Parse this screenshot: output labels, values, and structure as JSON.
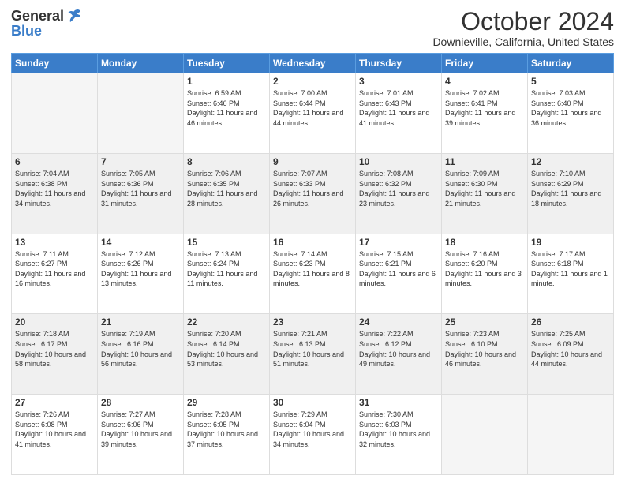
{
  "header": {
    "logo_general": "General",
    "logo_blue": "Blue",
    "month_title": "October 2024",
    "location": "Downieville, California, United States"
  },
  "days_of_week": [
    "Sunday",
    "Monday",
    "Tuesday",
    "Wednesday",
    "Thursday",
    "Friday",
    "Saturday"
  ],
  "weeks": [
    [
      {
        "day": "",
        "sunrise": "",
        "sunset": "",
        "daylight": "",
        "empty": true
      },
      {
        "day": "",
        "sunrise": "",
        "sunset": "",
        "daylight": "",
        "empty": true
      },
      {
        "day": "1",
        "sunrise": "Sunrise: 6:59 AM",
        "sunset": "Sunset: 6:46 PM",
        "daylight": "Daylight: 11 hours and 46 minutes."
      },
      {
        "day": "2",
        "sunrise": "Sunrise: 7:00 AM",
        "sunset": "Sunset: 6:44 PM",
        "daylight": "Daylight: 11 hours and 44 minutes."
      },
      {
        "day": "3",
        "sunrise": "Sunrise: 7:01 AM",
        "sunset": "Sunset: 6:43 PM",
        "daylight": "Daylight: 11 hours and 41 minutes."
      },
      {
        "day": "4",
        "sunrise": "Sunrise: 7:02 AM",
        "sunset": "Sunset: 6:41 PM",
        "daylight": "Daylight: 11 hours and 39 minutes."
      },
      {
        "day": "5",
        "sunrise": "Sunrise: 7:03 AM",
        "sunset": "Sunset: 6:40 PM",
        "daylight": "Daylight: 11 hours and 36 minutes."
      }
    ],
    [
      {
        "day": "6",
        "sunrise": "Sunrise: 7:04 AM",
        "sunset": "Sunset: 6:38 PM",
        "daylight": "Daylight: 11 hours and 34 minutes."
      },
      {
        "day": "7",
        "sunrise": "Sunrise: 7:05 AM",
        "sunset": "Sunset: 6:36 PM",
        "daylight": "Daylight: 11 hours and 31 minutes."
      },
      {
        "day": "8",
        "sunrise": "Sunrise: 7:06 AM",
        "sunset": "Sunset: 6:35 PM",
        "daylight": "Daylight: 11 hours and 28 minutes."
      },
      {
        "day": "9",
        "sunrise": "Sunrise: 7:07 AM",
        "sunset": "Sunset: 6:33 PM",
        "daylight": "Daylight: 11 hours and 26 minutes."
      },
      {
        "day": "10",
        "sunrise": "Sunrise: 7:08 AM",
        "sunset": "Sunset: 6:32 PM",
        "daylight": "Daylight: 11 hours and 23 minutes."
      },
      {
        "day": "11",
        "sunrise": "Sunrise: 7:09 AM",
        "sunset": "Sunset: 6:30 PM",
        "daylight": "Daylight: 11 hours and 21 minutes."
      },
      {
        "day": "12",
        "sunrise": "Sunrise: 7:10 AM",
        "sunset": "Sunset: 6:29 PM",
        "daylight": "Daylight: 11 hours and 18 minutes."
      }
    ],
    [
      {
        "day": "13",
        "sunrise": "Sunrise: 7:11 AM",
        "sunset": "Sunset: 6:27 PM",
        "daylight": "Daylight: 11 hours and 16 minutes."
      },
      {
        "day": "14",
        "sunrise": "Sunrise: 7:12 AM",
        "sunset": "Sunset: 6:26 PM",
        "daylight": "Daylight: 11 hours and 13 minutes."
      },
      {
        "day": "15",
        "sunrise": "Sunrise: 7:13 AM",
        "sunset": "Sunset: 6:24 PM",
        "daylight": "Daylight: 11 hours and 11 minutes."
      },
      {
        "day": "16",
        "sunrise": "Sunrise: 7:14 AM",
        "sunset": "Sunset: 6:23 PM",
        "daylight": "Daylight: 11 hours and 8 minutes."
      },
      {
        "day": "17",
        "sunrise": "Sunrise: 7:15 AM",
        "sunset": "Sunset: 6:21 PM",
        "daylight": "Daylight: 11 hours and 6 minutes."
      },
      {
        "day": "18",
        "sunrise": "Sunrise: 7:16 AM",
        "sunset": "Sunset: 6:20 PM",
        "daylight": "Daylight: 11 hours and 3 minutes."
      },
      {
        "day": "19",
        "sunrise": "Sunrise: 7:17 AM",
        "sunset": "Sunset: 6:18 PM",
        "daylight": "Daylight: 11 hours and 1 minute."
      }
    ],
    [
      {
        "day": "20",
        "sunrise": "Sunrise: 7:18 AM",
        "sunset": "Sunset: 6:17 PM",
        "daylight": "Daylight: 10 hours and 58 minutes."
      },
      {
        "day": "21",
        "sunrise": "Sunrise: 7:19 AM",
        "sunset": "Sunset: 6:16 PM",
        "daylight": "Daylight: 10 hours and 56 minutes."
      },
      {
        "day": "22",
        "sunrise": "Sunrise: 7:20 AM",
        "sunset": "Sunset: 6:14 PM",
        "daylight": "Daylight: 10 hours and 53 minutes."
      },
      {
        "day": "23",
        "sunrise": "Sunrise: 7:21 AM",
        "sunset": "Sunset: 6:13 PM",
        "daylight": "Daylight: 10 hours and 51 minutes."
      },
      {
        "day": "24",
        "sunrise": "Sunrise: 7:22 AM",
        "sunset": "Sunset: 6:12 PM",
        "daylight": "Daylight: 10 hours and 49 minutes."
      },
      {
        "day": "25",
        "sunrise": "Sunrise: 7:23 AM",
        "sunset": "Sunset: 6:10 PM",
        "daylight": "Daylight: 10 hours and 46 minutes."
      },
      {
        "day": "26",
        "sunrise": "Sunrise: 7:25 AM",
        "sunset": "Sunset: 6:09 PM",
        "daylight": "Daylight: 10 hours and 44 minutes."
      }
    ],
    [
      {
        "day": "27",
        "sunrise": "Sunrise: 7:26 AM",
        "sunset": "Sunset: 6:08 PM",
        "daylight": "Daylight: 10 hours and 41 minutes."
      },
      {
        "day": "28",
        "sunrise": "Sunrise: 7:27 AM",
        "sunset": "Sunset: 6:06 PM",
        "daylight": "Daylight: 10 hours and 39 minutes."
      },
      {
        "day": "29",
        "sunrise": "Sunrise: 7:28 AM",
        "sunset": "Sunset: 6:05 PM",
        "daylight": "Daylight: 10 hours and 37 minutes."
      },
      {
        "day": "30",
        "sunrise": "Sunrise: 7:29 AM",
        "sunset": "Sunset: 6:04 PM",
        "daylight": "Daylight: 10 hours and 34 minutes."
      },
      {
        "day": "31",
        "sunrise": "Sunrise: 7:30 AM",
        "sunset": "Sunset: 6:03 PM",
        "daylight": "Daylight: 10 hours and 32 minutes."
      },
      {
        "day": "",
        "sunrise": "",
        "sunset": "",
        "daylight": "",
        "empty": true
      },
      {
        "day": "",
        "sunrise": "",
        "sunset": "",
        "daylight": "",
        "empty": true
      }
    ]
  ]
}
